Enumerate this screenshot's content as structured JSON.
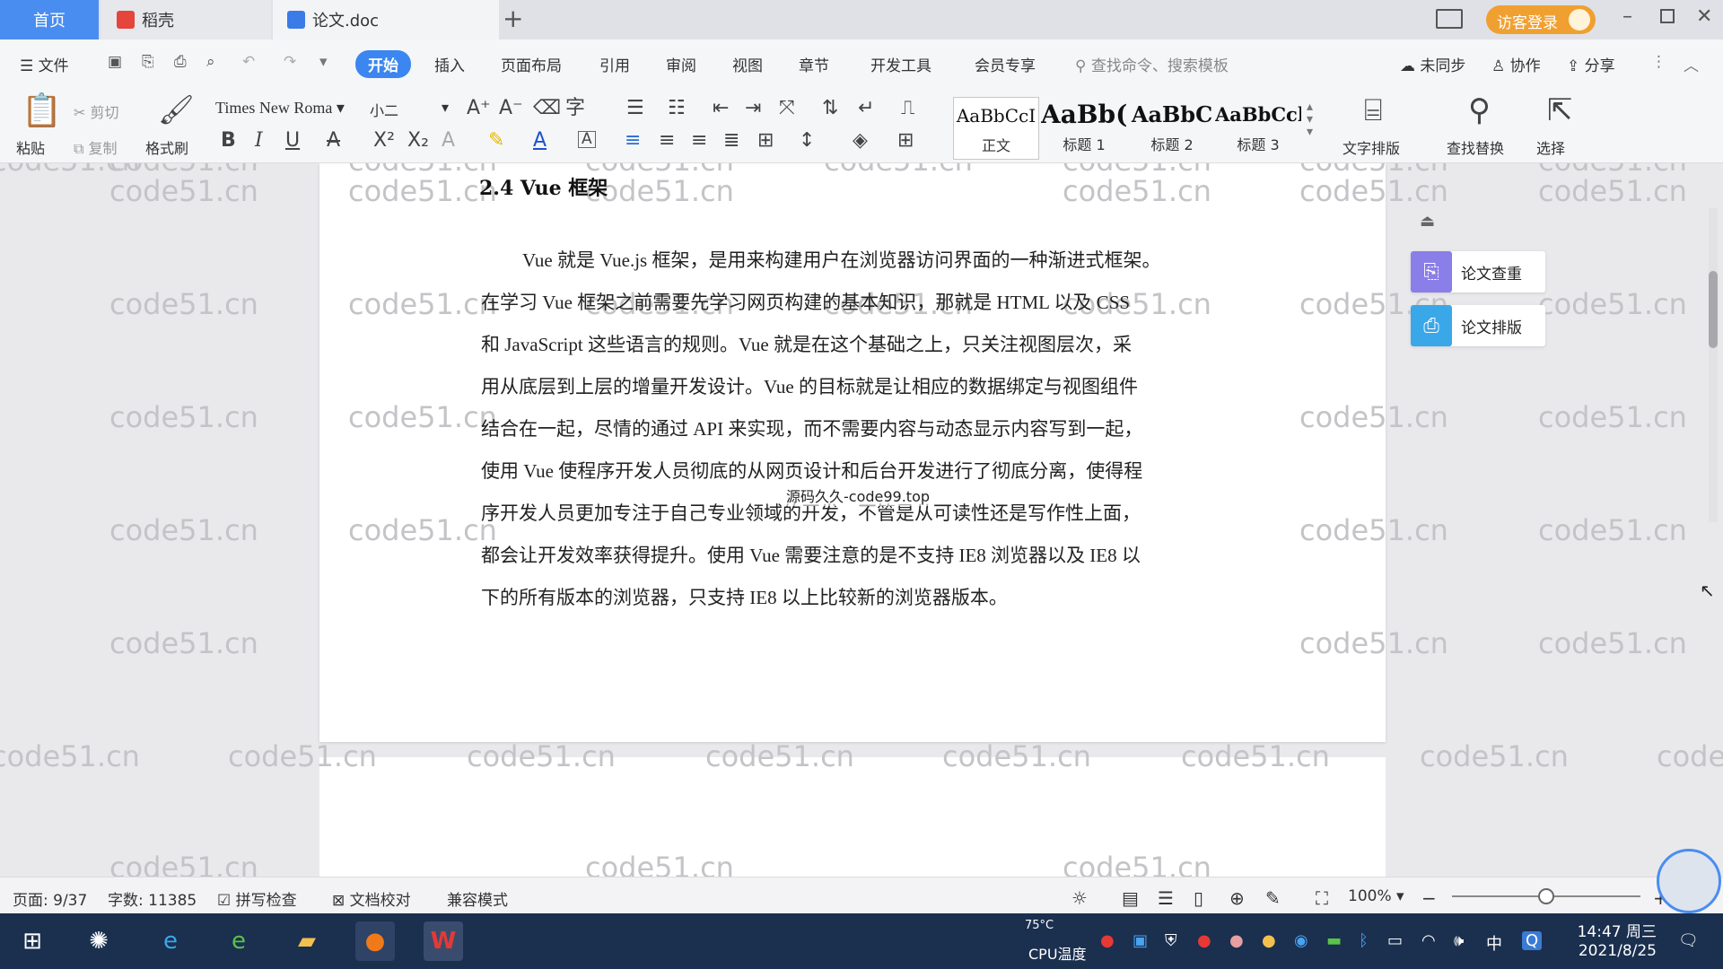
{
  "tabs": {
    "home": "首页",
    "daoke": "稻壳",
    "doc": "论文.doc",
    "new_tab": "+",
    "login": "访客登录"
  },
  "menu": {
    "file": "文件",
    "items": [
      "开始",
      "插入",
      "页面布局",
      "引用",
      "审阅",
      "视图",
      "章节",
      "开发工具",
      "会员专享"
    ],
    "search_placeholder": "查找命令、搜索模板",
    "sync": "未同步",
    "collab": "协作",
    "share": "分享"
  },
  "ribbon": {
    "paste": "粘贴",
    "cut": "剪切",
    "copy": "复制",
    "format_painter": "格式刷",
    "font_name": "Times New Roma",
    "font_size": "小二",
    "styles": [
      {
        "preview": "AaBbCcI",
        "label": "正文"
      },
      {
        "preview": "AaBb(",
        "label": "标题 1"
      },
      {
        "preview": "AaBbC",
        "label": "标题 2"
      },
      {
        "preview": "AaBbCcl",
        "label": "标题 3"
      }
    ],
    "text_layout": "文字排版",
    "find_replace": "查找替换",
    "select": "选择"
  },
  "document": {
    "heading": "2.4 Vue 框架",
    "lines": [
      "Vue 就是 Vue.js 框架，是用来构建用户在浏览器访问界面的一种渐进式框架。",
      "在学习 Vue 框架之前需要先学习网页构建的基本知识，那就是 HTML 以及 CSS",
      "和 JavaScript 这些语言的规则。Vue 就是在这个基础之上，只关注视图层次，采",
      "用从底层到上层的增量开发设计。Vue 的目标就是让相应的数据绑定与视图组件",
      "结合在一起，尽情的通过 API 来实现，而不需要内容与动态显示内容写到一起，",
      "使用 Vue 使程序开发人员彻底的从网页设计和后台开发进行了彻底分离，使得程",
      "序开发人员更加专注于自己专业领域的开发，不管是从可读性还是写作性上面，",
      "都会让开发效率获得提升。使用 Vue 需要注意的是不支持 IE8 浏览器以及 IE8 以",
      "下的所有版本的浏览器，只支持 IE8 以上比较新的浏览器版本。"
    ],
    "overlay_text": "源码久久-code99.top",
    "watermark": "code51.cn"
  },
  "side_panel": {
    "check": "论文查重",
    "layout": "论文排版"
  },
  "status": {
    "page": "页面: 9/37",
    "words": "字数: 11385",
    "spell": "拼写检查",
    "proof": "文档校对",
    "compat": "兼容模式",
    "zoom": "100%",
    "zoom_level": 0.5
  },
  "taskbar": {
    "cpu_temp": "75°C",
    "cpu_label": "CPU温度",
    "ime": "中",
    "time": "14:47 周三",
    "date": "2021/8/25"
  }
}
